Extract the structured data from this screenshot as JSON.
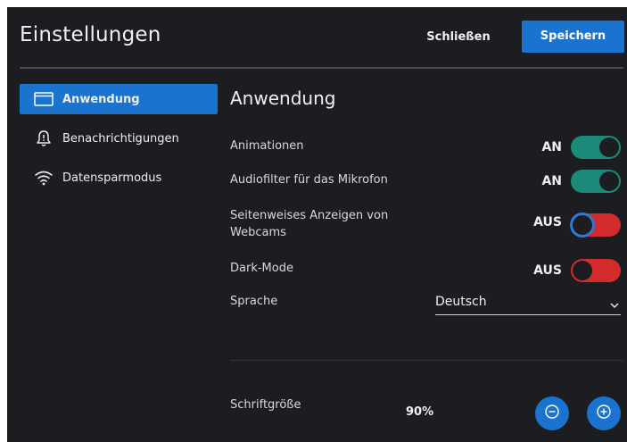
{
  "header": {
    "title": "Einstellungen",
    "close_label": "Schließen",
    "save_label": "Speichern"
  },
  "sidebar": {
    "items": [
      {
        "label": "Anwendung",
        "icon": "window-icon",
        "active": true
      },
      {
        "label": "Benachrichtigungen",
        "icon": "bell-icon",
        "active": false
      },
      {
        "label": "Datensparmodus",
        "icon": "wifi-icon",
        "active": false
      }
    ]
  },
  "main": {
    "section_title": "Anwendung",
    "settings": [
      {
        "label": "Animationen",
        "state": "AN",
        "on": true
      },
      {
        "label": "Audiofilter für das Mikrofon",
        "state": "AN",
        "on": true
      },
      {
        "label": "Seitenweises Anzeigen von Webcams",
        "state": "AUS",
        "on": false
      },
      {
        "label": "Dark-Mode",
        "state": "AUS",
        "on": false
      }
    ],
    "language": {
      "label": "Sprache",
      "value": "Deutsch"
    },
    "font_size": {
      "label": "Schriftgröße",
      "value": "90%"
    }
  },
  "colors": {
    "accent": "#1b73d0",
    "toggle_on": "#1b8a7a",
    "toggle_off": "#d22b2b",
    "background": "#1c1d21"
  }
}
